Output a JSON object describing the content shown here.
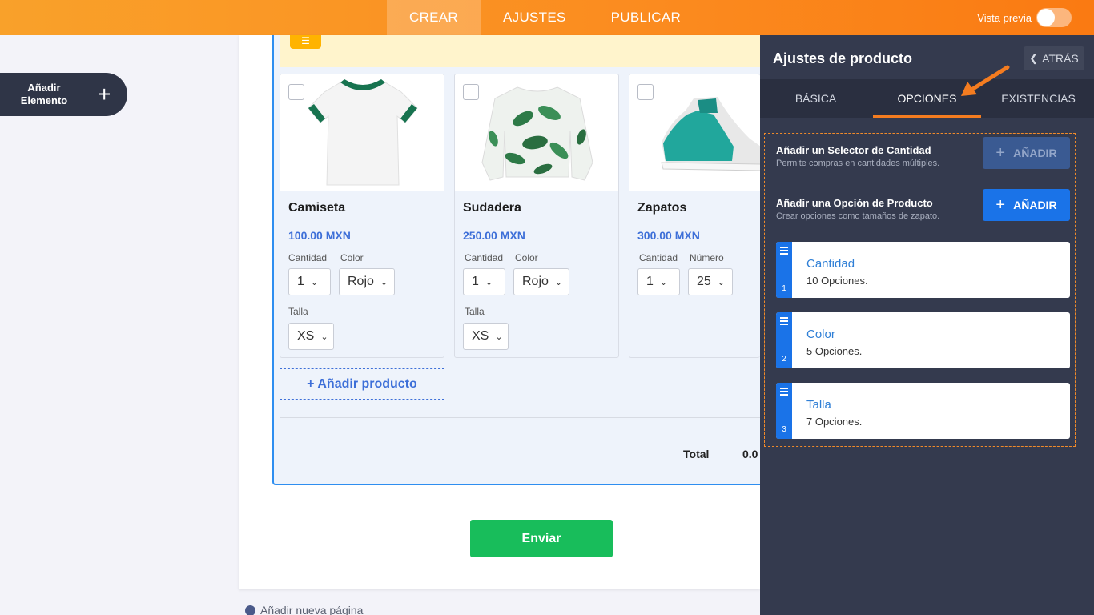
{
  "topbar": {
    "tabs": [
      {
        "label": "CREAR",
        "active": true
      },
      {
        "label": "AJUSTES",
        "active": false
      },
      {
        "label": "PUBLICAR",
        "active": false
      }
    ],
    "preview_label": "Vista previa",
    "preview_on": false
  },
  "sidebar": {
    "add_element_line1": "Añadir",
    "add_element_line2": "Elemento",
    "add_element_icon": "plus-icon"
  },
  "products": [
    {
      "name": "Camiseta",
      "price": "100.00 MXN",
      "image": "white-tshirt",
      "fields": [
        {
          "label": "Cantidad",
          "value": "1"
        },
        {
          "label": "Color",
          "value": "Rojo"
        },
        {
          "label": "Talla",
          "value": "XS"
        }
      ]
    },
    {
      "name": "Sudadera",
      "price": "250.00 MXN",
      "image": "leaf-sweatshirt",
      "fields": [
        {
          "label": "Cantidad",
          "value": "1"
        },
        {
          "label": "Color",
          "value": "Rojo"
        },
        {
          "label": "Talla",
          "value": "XS"
        }
      ]
    },
    {
      "name": "Zapatos",
      "price": "300.00 MXN",
      "image": "teal-sneaker",
      "fields": [
        {
          "label": "Cantidad",
          "value": "1"
        },
        {
          "label": "Número",
          "value": "25"
        }
      ]
    }
  ],
  "form": {
    "add_product_label": "+ Añadir producto",
    "total_label": "Total",
    "total_value": "0.0",
    "submit_label": "Enviar",
    "new_page_label": "Añadir nueva página"
  },
  "panel": {
    "title": "Ajustes de producto",
    "back_label": "ATRÁS",
    "tabs": [
      {
        "label": "BÁSICA",
        "active": false
      },
      {
        "label": "OPCIONES",
        "active": true
      },
      {
        "label": "EXISTENCIAS",
        "active": false
      }
    ],
    "quantity_selector": {
      "title": "Añadir un Selector de Cantidad",
      "subtitle": "Permite compras en cantidades múltiples.",
      "button": "AÑADIR",
      "enabled": false
    },
    "product_option": {
      "title": "Añadir una Opción de Producto",
      "subtitle": "Crear opciones como tamaños de zapato.",
      "button": "AÑADIR",
      "enabled": true
    },
    "options": [
      {
        "index": "1",
        "name": "Cantidad",
        "count": "10 Opciones."
      },
      {
        "index": "2",
        "name": "Color",
        "count": "5 Opciones."
      },
      {
        "index": "3",
        "name": "Talla",
        "count": "7 Opciones."
      }
    ]
  },
  "colors": {
    "accent_orange": "#f47c20",
    "primary_blue": "#1a73e8",
    "submit_green": "#18bd5b",
    "panel_bg": "#343a4e",
    "price_blue": "#3d6fd8"
  }
}
